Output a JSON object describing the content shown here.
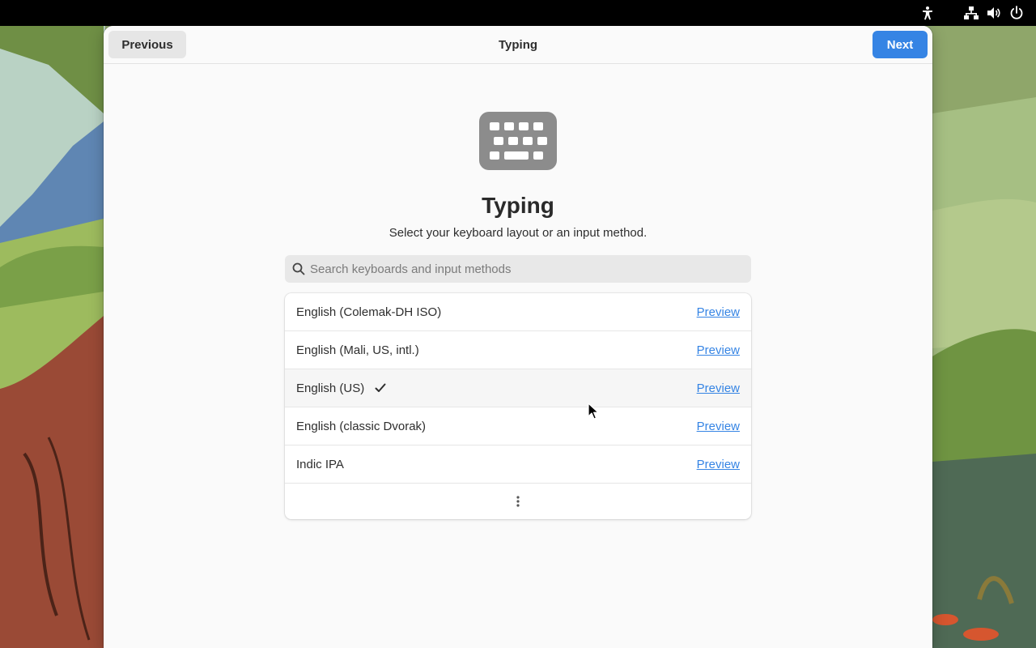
{
  "header": {
    "title": "Typing",
    "previous_label": "Previous",
    "next_label": "Next"
  },
  "tray": {
    "icons": [
      "accessibility-icon",
      "network-icon",
      "volume-icon",
      "power-icon"
    ]
  },
  "main": {
    "icon": "keyboard-icon",
    "heading": "Typing",
    "description": "Select your keyboard layout or an input method."
  },
  "search": {
    "placeholder": "Search keyboards and input methods",
    "value": ""
  },
  "layouts": [
    {
      "label": "English (Colemak-DH ISO)",
      "preview": "Preview",
      "selected": false
    },
    {
      "label": "English (Mali, US, intl.)",
      "preview": "Preview",
      "selected": false
    },
    {
      "label": "English (US)",
      "preview": "Preview",
      "selected": true
    },
    {
      "label": "English (classic Dvorak)",
      "preview": "Preview",
      "selected": false
    },
    {
      "label": "Indic IPA",
      "preview": "Preview",
      "selected": false
    }
  ],
  "colors": {
    "accent": "#3584e4",
    "window_bg": "#fafafa",
    "topbar_bg": "#000000"
  }
}
